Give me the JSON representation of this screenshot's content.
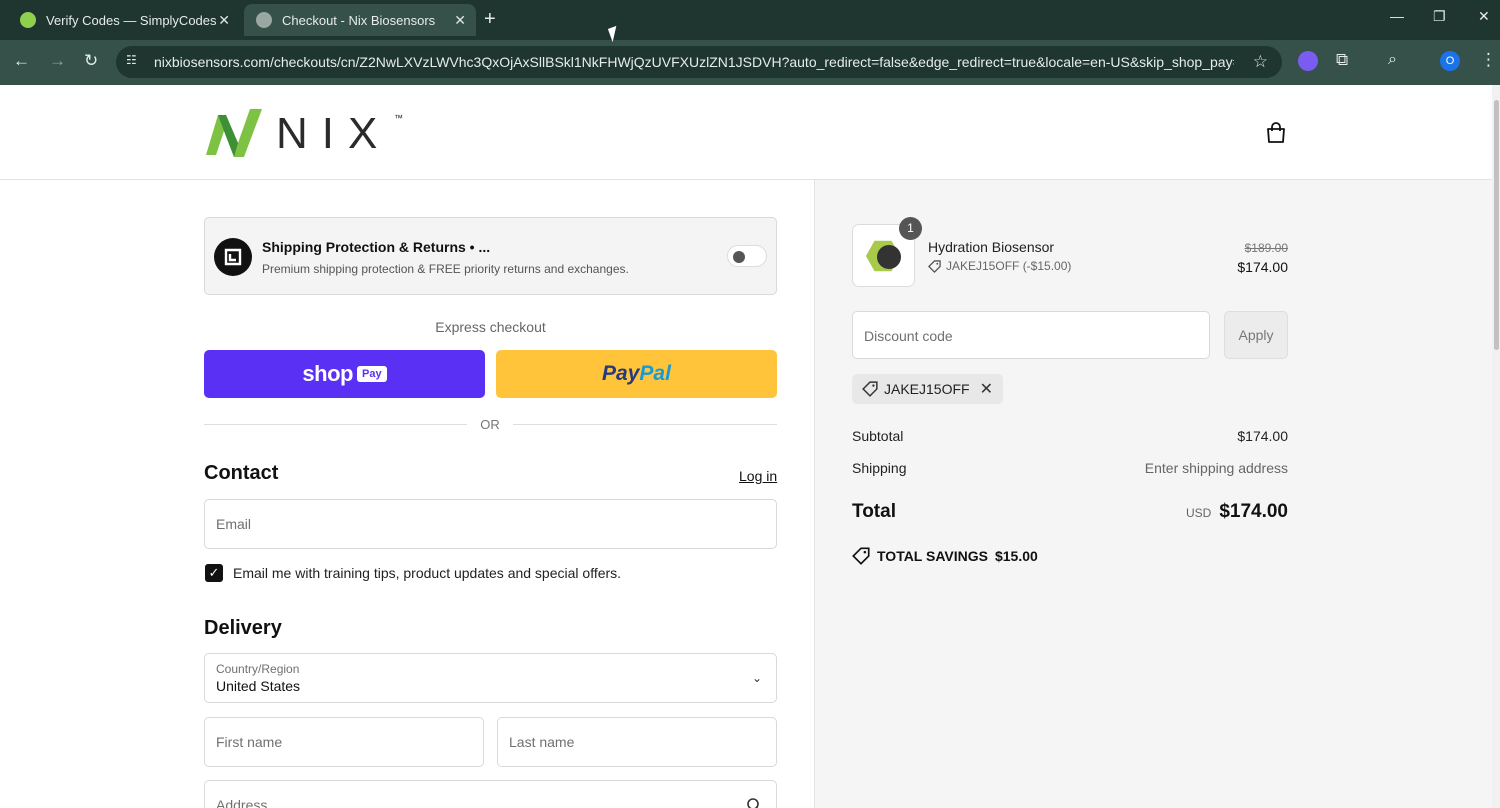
{
  "browser": {
    "tabs": [
      {
        "title": "Verify Codes — SimplyCodes",
        "active": false
      },
      {
        "title": "Checkout - Nix Biosensors",
        "active": true
      }
    ],
    "url": "nixbiosensors.com/checkouts/cn/Z2NwLXVzLWVhc3QxOjAxSllBSkl1NkFHWjQzUVFXUzlZN1JSDVH?auto_redirect=false&edge_redirect=true&locale=en-US&skip_shop_pay=true",
    "profile_initial": "O"
  },
  "header": {
    "logo_text": "NIX",
    "trademark": "™"
  },
  "protection": {
    "title": "Shipping Protection & Returns • ...",
    "subtitle": "Premium shipping protection & FREE priority returns and exchanges.",
    "enabled": false
  },
  "express": {
    "label": "Express checkout",
    "shoppay_label": "shop",
    "shoppay_badge": "Pay",
    "paypal_label_1": "Pay",
    "paypal_label_2": "Pal",
    "or_label": "OR"
  },
  "contact": {
    "heading": "Contact",
    "login_label": "Log in",
    "email_placeholder": "Email",
    "marketing_label": "Email me with training tips, product updates and special offers.",
    "marketing_checked": true
  },
  "delivery": {
    "heading": "Delivery",
    "country_label": "Country/Region",
    "country_value": "United States",
    "first_name_placeholder": "First name",
    "last_name_placeholder": "Last name",
    "address_placeholder": "Address"
  },
  "order": {
    "item": {
      "quantity": "1",
      "name": "Hydration Biosensor",
      "discount": "JAKEJ15OFF (-$15.00)",
      "original_price": "$189.00",
      "price": "$174.00"
    },
    "discount_placeholder": "Discount code",
    "apply_label": "Apply",
    "applied_code": "JAKEJ15OFF",
    "subtotal_label": "Subtotal",
    "subtotal_value": "$174.00",
    "shipping_label": "Shipping",
    "shipping_value": "Enter shipping address",
    "total_label": "Total",
    "currency": "USD",
    "total_value": "$174.00",
    "savings_label": "TOTAL SAVINGS",
    "savings_value": "$15.00"
  },
  "colors": {
    "shoppay": "#5a31f4",
    "paypal": "#ffc43a",
    "logo_green": "#7dc242"
  }
}
